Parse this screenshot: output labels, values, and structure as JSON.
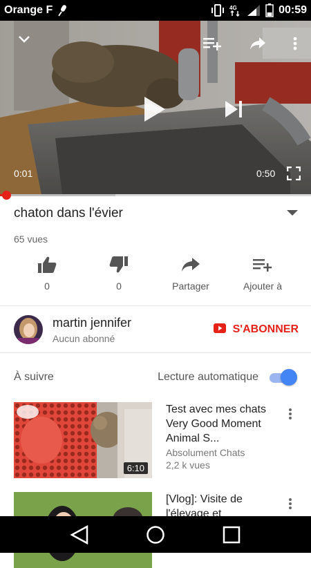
{
  "status_bar": {
    "carrier": "Orange F",
    "time": "00:59"
  },
  "player": {
    "elapsed": "0:01",
    "duration": "0:50",
    "progress": 0.02,
    "buffered": 0.37
  },
  "video": {
    "title": "chaton dans l'évier",
    "views": "65 vues",
    "like_count": "0",
    "dislike_count": "0",
    "share_label": "Partager",
    "add_label": "Ajouter à"
  },
  "channel": {
    "name": "martin jennifer",
    "subscribers": "Aucun abonné",
    "subscribe_label": "S'ABONNER"
  },
  "up_next": {
    "label": "À suivre",
    "autoplay_label": "Lecture automatique",
    "autoplay_on": true
  },
  "suggestions": [
    {
      "title": "Test avec mes chats Very Good Moment  Animal S...",
      "channel": "Absolument Chats",
      "views": "2,2 k vues",
      "duration": "6:10"
    },
    {
      "title": "[Vlog]: Visite de l'élevage et",
      "channel": "",
      "views": "",
      "duration": ""
    }
  ],
  "colors": {
    "accent_red": "#e62117",
    "toggle_blue": "#4385f4"
  }
}
